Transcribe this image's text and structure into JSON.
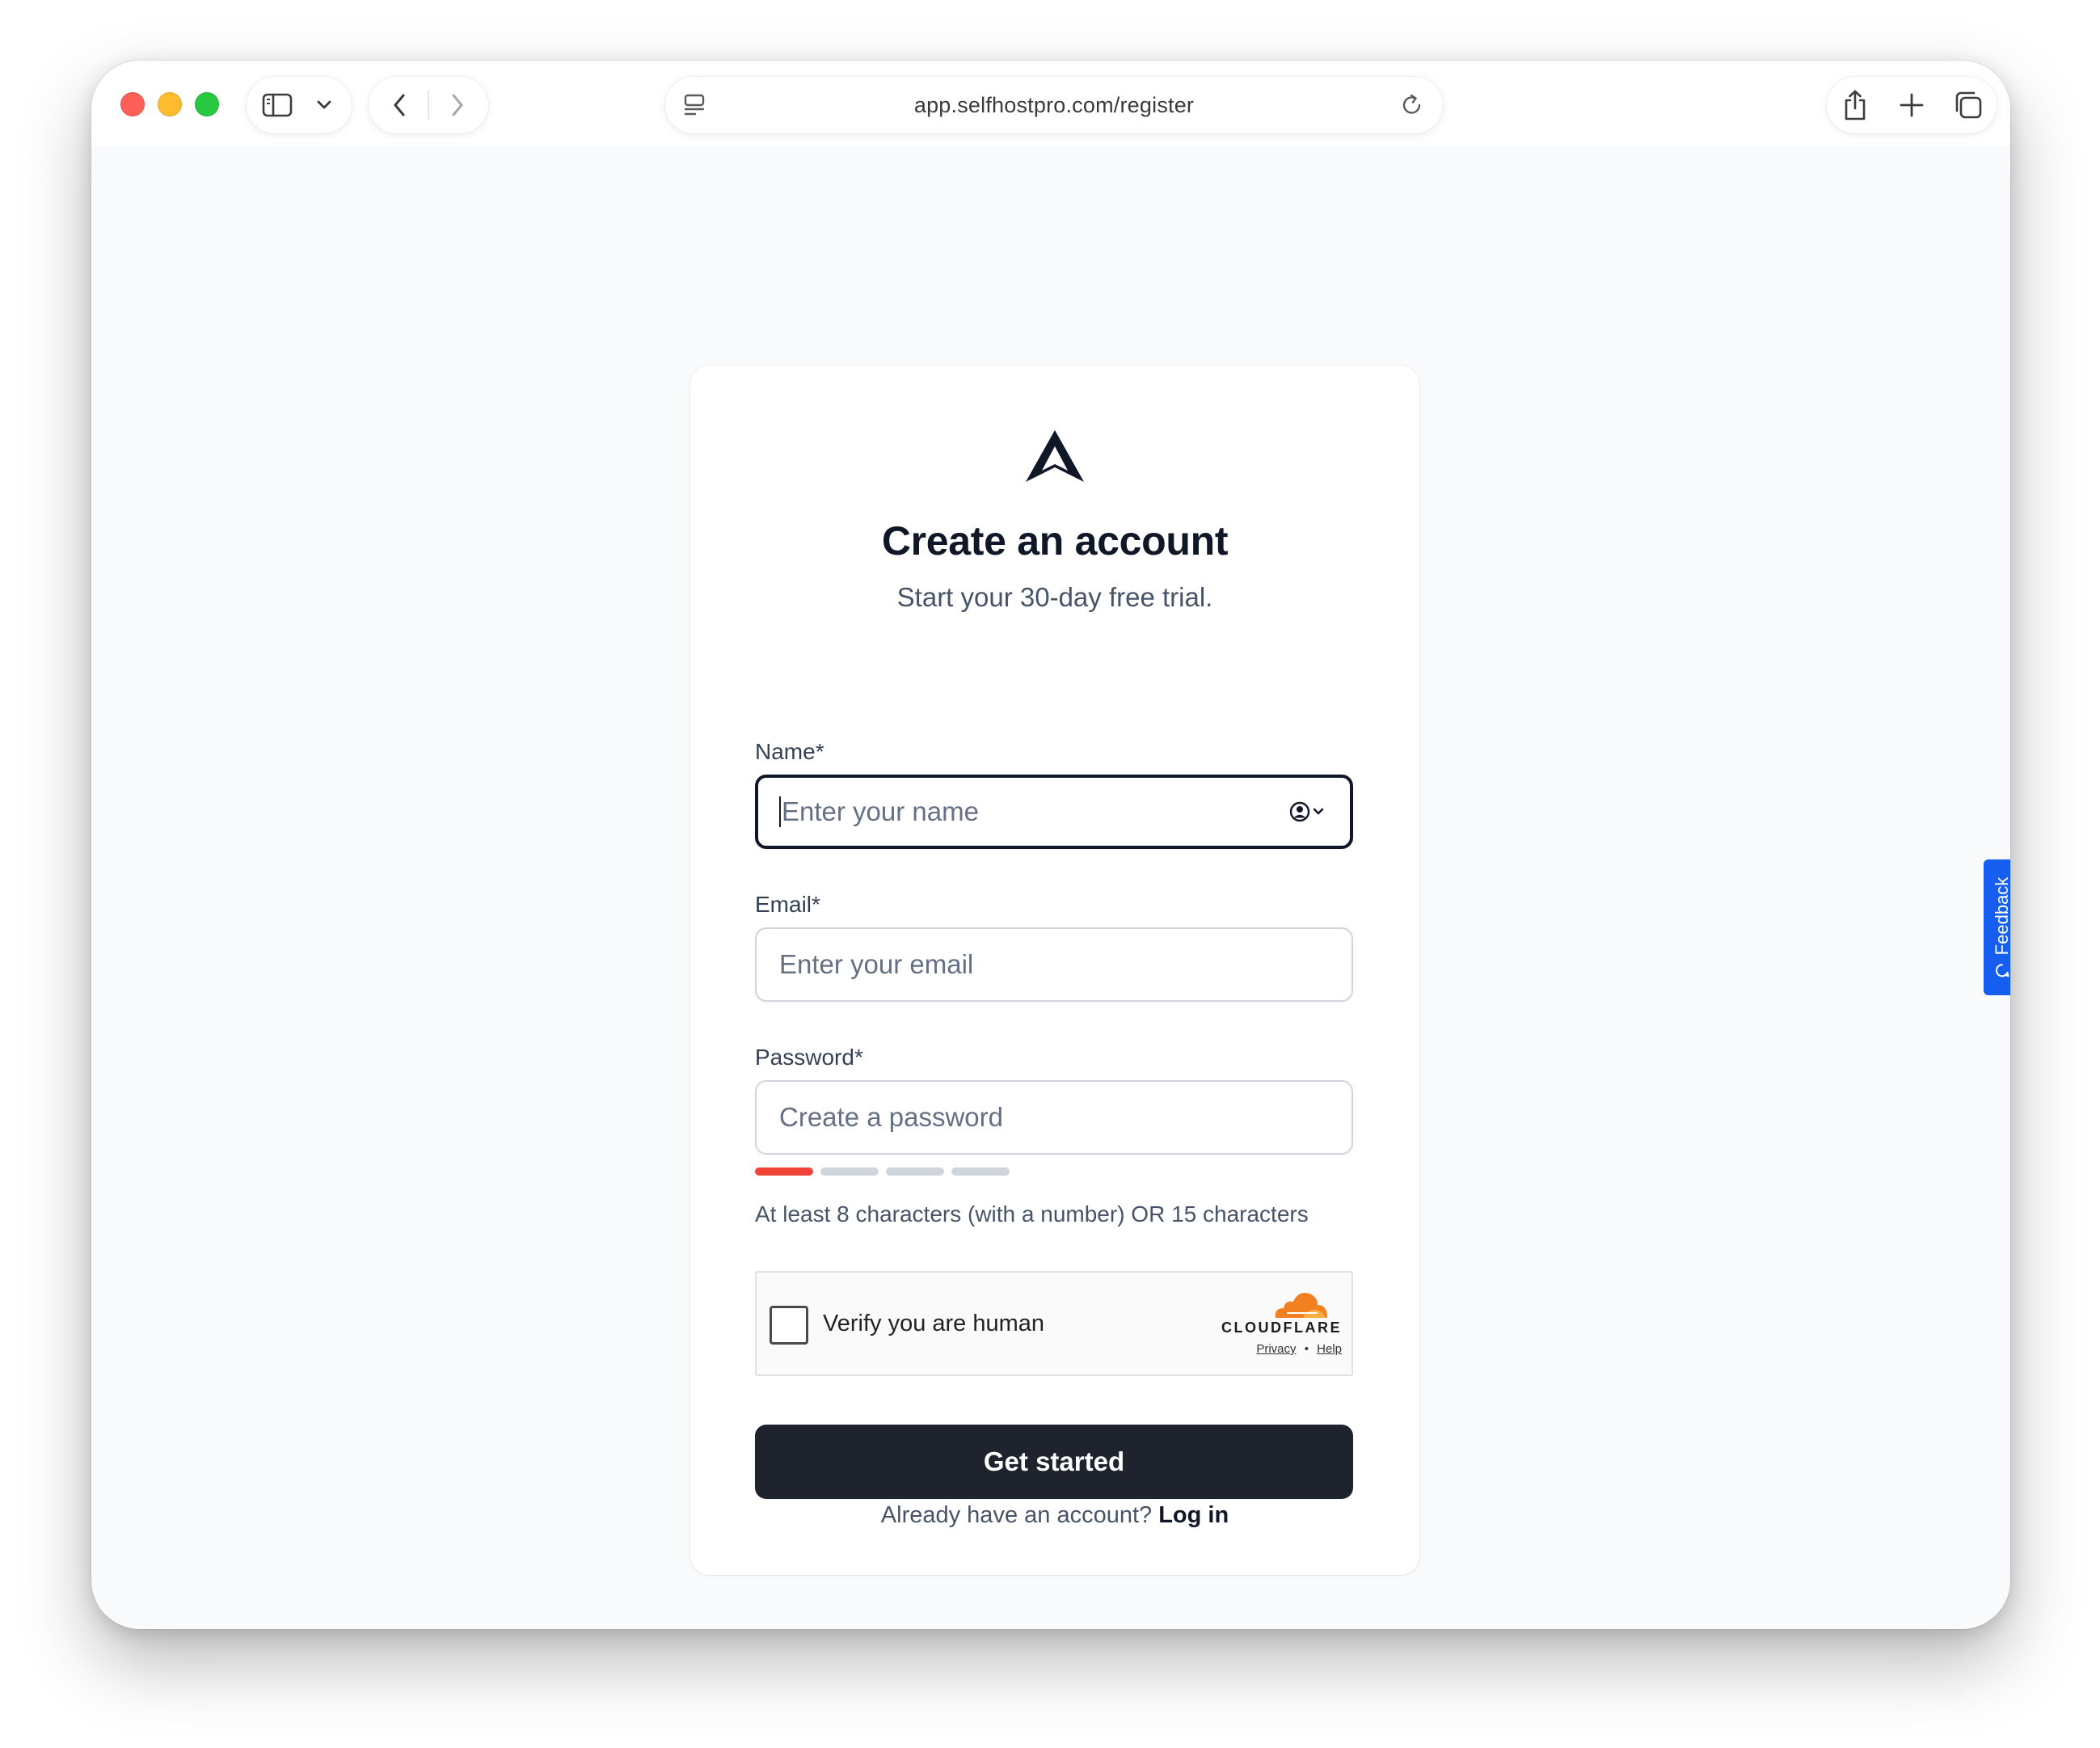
{
  "browser": {
    "url": "app.selfhostpro.com/register"
  },
  "icons": {
    "traffic": [
      "close-button",
      "minimize-button",
      "zoom-button"
    ],
    "toolbar": [
      "sidebar-icon",
      "chevron-down-icon",
      "back-icon",
      "forward-icon",
      "page-menu-icon",
      "reload-icon",
      "share-icon",
      "plus-icon",
      "tabs-overview-icon"
    ],
    "autofill": "contact-autofill-icon",
    "feedback": "feedback-bubble-icon",
    "brand_logo": "triangle-logo-icon",
    "cloudflare": "cloudflare-cloud-icon"
  },
  "colors": {
    "brand_dark": "#101828",
    "button_bg": "#1f232d",
    "strength_active": "#f04438",
    "strength_inactive": "#d0d5dd",
    "feedback_bg": "#155eef",
    "cloudflare_orange": "#f38020"
  },
  "form": {
    "title": "Create an account",
    "subtitle": "Start your 30-day free trial.",
    "name": {
      "label": "Name*",
      "placeholder": "Enter your name",
      "focused": true
    },
    "email": {
      "label": "Email*",
      "placeholder": "Enter your email"
    },
    "password": {
      "label": "Password*",
      "placeholder": "Create a password",
      "strength_level": 1,
      "strength_max": 4,
      "hint": "At least 8 characters (with a number) OR 15 characters"
    },
    "captcha": {
      "label": "Verify you are human",
      "provider": "CLOUDFLARE",
      "privacy": "Privacy",
      "separator": "•",
      "help": "Help"
    },
    "submit_label": "Get started",
    "footer_text": "Already have an account?",
    "login_label": "Log in"
  },
  "feedback": {
    "label": "Feedback"
  }
}
